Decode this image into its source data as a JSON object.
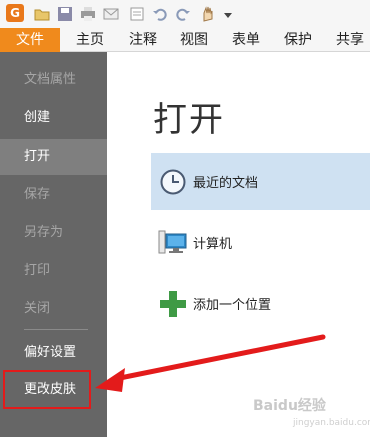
{
  "tabs": {
    "file": "文件",
    "home": "主页",
    "comment": "注释",
    "view": "视图",
    "form": "表单",
    "protect": "保护",
    "share": "共享"
  },
  "toolbar_icons": [
    "app-logo-icon",
    "open-folder-icon",
    "save-icon",
    "print-icon",
    "email-icon",
    "undo-icon",
    "redo-icon",
    "hand-icon",
    "dropdown-icon"
  ],
  "backstage": {
    "items": [
      {
        "label": "文档属性",
        "state": "disabled"
      },
      {
        "label": "创建",
        "state": "enabled"
      },
      {
        "label": "打开",
        "state": "selected"
      },
      {
        "label": "保存",
        "state": "disabled"
      },
      {
        "label": "另存为",
        "state": "disabled"
      },
      {
        "label": "打印",
        "state": "disabled"
      },
      {
        "label": "关闭",
        "state": "disabled"
      },
      {
        "label": "偏好设置",
        "state": "enabled"
      },
      {
        "label": "更改皮肤",
        "state": "enabled"
      }
    ]
  },
  "content": {
    "title": "打开",
    "options": [
      {
        "label": "最近的文档",
        "icon": "clock-icon",
        "selected": true
      },
      {
        "label": "计算机",
        "icon": "computer-icon",
        "selected": false
      },
      {
        "label": "添加一个位置",
        "icon": "plus-icon",
        "selected": false
      }
    ]
  },
  "watermark": {
    "text": "Baidu经验",
    "sub": "jingyan.baidu.com"
  },
  "colors": {
    "accent_orange": "#f08a1c",
    "backstage_bg": "#666666",
    "selection_blue": "#cfe1f2",
    "annotation_red": "#e31b1b"
  }
}
